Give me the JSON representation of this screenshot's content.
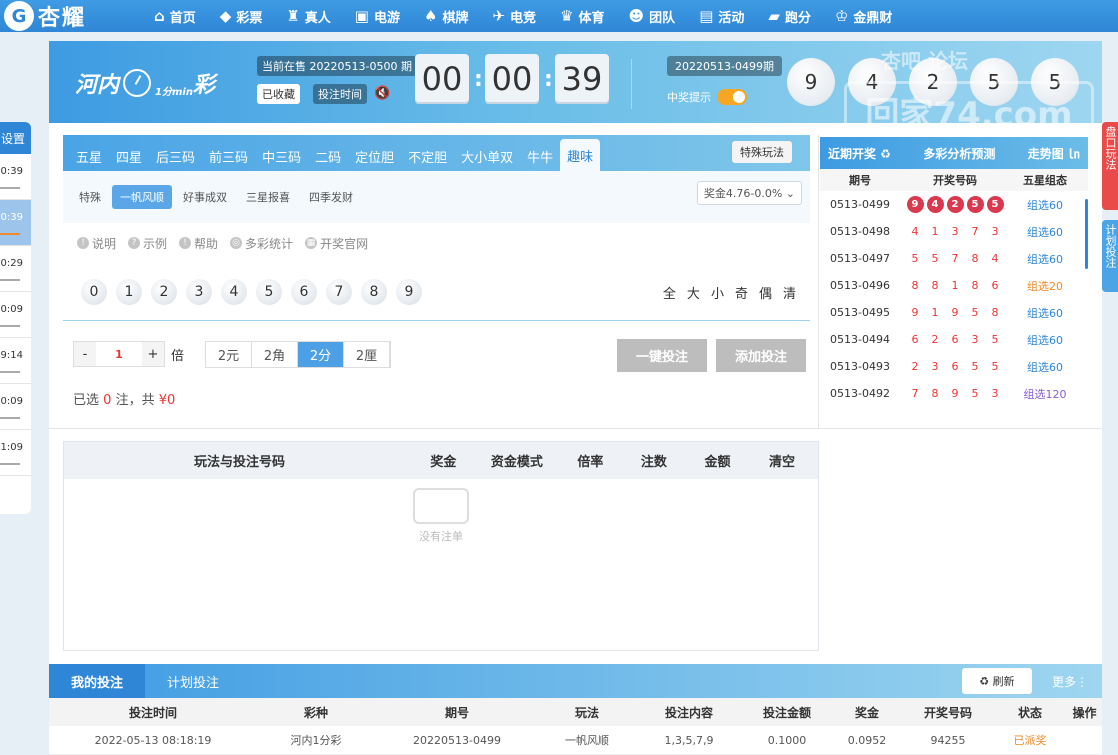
{
  "brand": {
    "logo_text": "杏耀",
    "logo_mark": "G"
  },
  "nav": [
    {
      "icon": "⌂",
      "icon_name": "home-icon",
      "label": "首页"
    },
    {
      "icon": "◆",
      "icon_name": "lottery-icon",
      "label": "彩票"
    },
    {
      "icon": "♜",
      "icon_name": "live-icon",
      "label": "真人"
    },
    {
      "icon": "▣",
      "icon_name": "egame-icon",
      "label": "电游"
    },
    {
      "icon": "♠",
      "icon_name": "chess-icon",
      "label": "棋牌"
    },
    {
      "icon": "✈",
      "icon_name": "esports-icon",
      "label": "电竞"
    },
    {
      "icon": "♛",
      "icon_name": "sports-icon",
      "label": "体育"
    },
    {
      "icon": "☻",
      "icon_name": "team-icon",
      "label": "团队"
    },
    {
      "icon": "▤",
      "icon_name": "gift-icon",
      "label": "活动"
    },
    {
      "icon": "▰",
      "icon_name": "race-icon",
      "label": "跑分"
    },
    {
      "icon": "♔",
      "icon_name": "coin-icon",
      "label": "金鼎财"
    }
  ],
  "left_panel": {
    "title": "设置",
    "items": [
      "0:39",
      "0:39",
      "0:29",
      "0:09",
      "9:14",
      "0:09",
      "1:09"
    ]
  },
  "game": {
    "logo_left": "河内",
    "logo_sub": "1分min",
    "logo_right": "彩",
    "current_label": "当前在售 20220513-0500 期",
    "fav_label": "已收藏",
    "bettime_label": "投注时间",
    "countdown": [
      "00",
      "00",
      "39"
    ],
    "prev_label": "20220513-0499期",
    "win_tip": "中奖提示",
    "result_balls": [
      "9",
      "4",
      "2",
      "5",
      "5"
    ]
  },
  "watermark": {
    "top": "杏吧 论坛",
    "main": "回家74.com"
  },
  "tabs": [
    "五星",
    "四星",
    "后三码",
    "前三码",
    "中三码",
    "二码",
    "定位胆",
    "不定胆",
    "大小单双",
    "牛牛",
    "趣味"
  ],
  "special_play": "特殊玩法",
  "subtabs": [
    "特殊",
    "一帆风顺",
    "好事成双",
    "三星报喜",
    "四季发财"
  ],
  "prize_select": "奖金4.76-0.0%",
  "help_links": [
    "说明",
    "示例",
    "帮助",
    "多彩统计",
    "开奖官网"
  ],
  "digits": [
    "0",
    "1",
    "2",
    "3",
    "4",
    "5",
    "6",
    "7",
    "8",
    "9"
  ],
  "filters": [
    "全",
    "大",
    "小",
    "奇",
    "偶",
    "清"
  ],
  "multiplier": {
    "minus": "-",
    "value": "1",
    "plus": "+",
    "unit": "倍"
  },
  "money_units": [
    "2元",
    "2角",
    "2分",
    "2厘"
  ],
  "quick_bet": "一键投注",
  "add_bet": "添加投注",
  "summary": {
    "prefix": "已选",
    "count": "0",
    "mid": "注，共",
    "amount": "¥0"
  },
  "draw_panel": {
    "tabs": [
      "近期开奖 ♻",
      "多彩分析预测",
      "走势图 ㏑"
    ],
    "cols": [
      "期号",
      "开奖号码",
      "五星组态"
    ],
    "rows": [
      {
        "issue": "0513-0499",
        "nums": [
          "9",
          "4",
          "2",
          "5",
          "5"
        ],
        "type": "组选60",
        "color": "#2f86d6"
      },
      {
        "issue": "0513-0498",
        "nums": [
          "4",
          "1",
          "3",
          "7",
          "3"
        ],
        "type": "组选60",
        "color": "#2f86d6"
      },
      {
        "issue": "0513-0497",
        "nums": [
          "5",
          "5",
          "7",
          "8",
          "4"
        ],
        "type": "组选60",
        "color": "#2f86d6"
      },
      {
        "issue": "0513-0496",
        "nums": [
          "8",
          "8",
          "1",
          "8",
          "6"
        ],
        "type": "组选20",
        "color": "#f08a2a"
      },
      {
        "issue": "0513-0495",
        "nums": [
          "9",
          "1",
          "9",
          "5",
          "8"
        ],
        "type": "组选60",
        "color": "#2f86d6"
      },
      {
        "issue": "0513-0494",
        "nums": [
          "6",
          "2",
          "6",
          "3",
          "5"
        ],
        "type": "组选60",
        "color": "#2f86d6"
      },
      {
        "issue": "0513-0493",
        "nums": [
          "2",
          "3",
          "6",
          "5",
          "5"
        ],
        "type": "组选60",
        "color": "#2f86d6"
      },
      {
        "issue": "0513-0492",
        "nums": [
          "7",
          "8",
          "9",
          "5",
          "3"
        ],
        "type": "组选120",
        "color": "#8a5cd6"
      }
    ]
  },
  "bet_list": {
    "cols": [
      "玩法与投注号码",
      "奖金",
      "资金模式",
      "倍率",
      "注数",
      "金额",
      "清空"
    ],
    "empty": "没有注单"
  },
  "my_bets": {
    "tabs": [
      "我的投注",
      "计划投注"
    ],
    "refresh": "刷新",
    "more": "更多⋮",
    "cols": [
      "投注时间",
      "彩种",
      "期号",
      "玩法",
      "投注内容",
      "投注金额",
      "奖金",
      "开奖号码",
      "状态",
      "操作"
    ],
    "rows": [
      [
        "2022-05-13 08:18:19",
        "河内1分彩",
        "20220513-0499",
        "一帆风顺",
        "1,3,5,7,9",
        "0.1000",
        "0.0952",
        "94255",
        "已派奖",
        ""
      ]
    ]
  },
  "right_tabs": [
    "盘口玩法",
    "计划投注"
  ]
}
